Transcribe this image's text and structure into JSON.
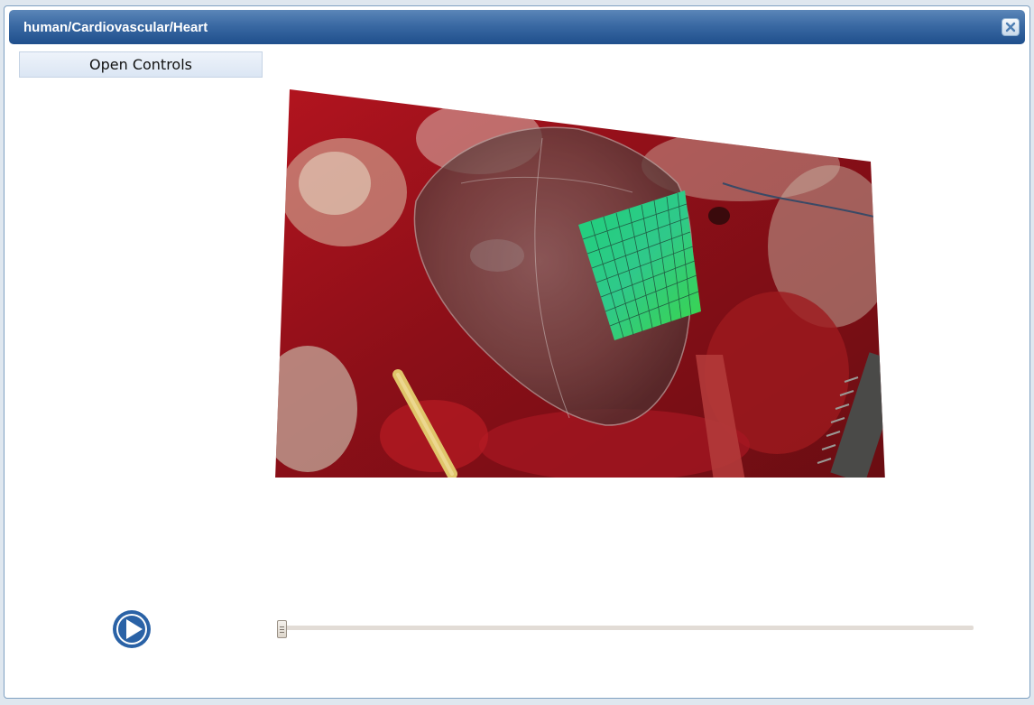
{
  "window": {
    "title": "human/Cardiovascular/Heart"
  },
  "controls": {
    "open_label": "Open Controls"
  },
  "player": {
    "progress": 0
  },
  "colors": {
    "titlebar": "#2d5f9c",
    "play_button": "#2a62a6",
    "mesh": "#2fd073"
  },
  "icons": {
    "close": "close-icon",
    "play": "play-icon"
  }
}
